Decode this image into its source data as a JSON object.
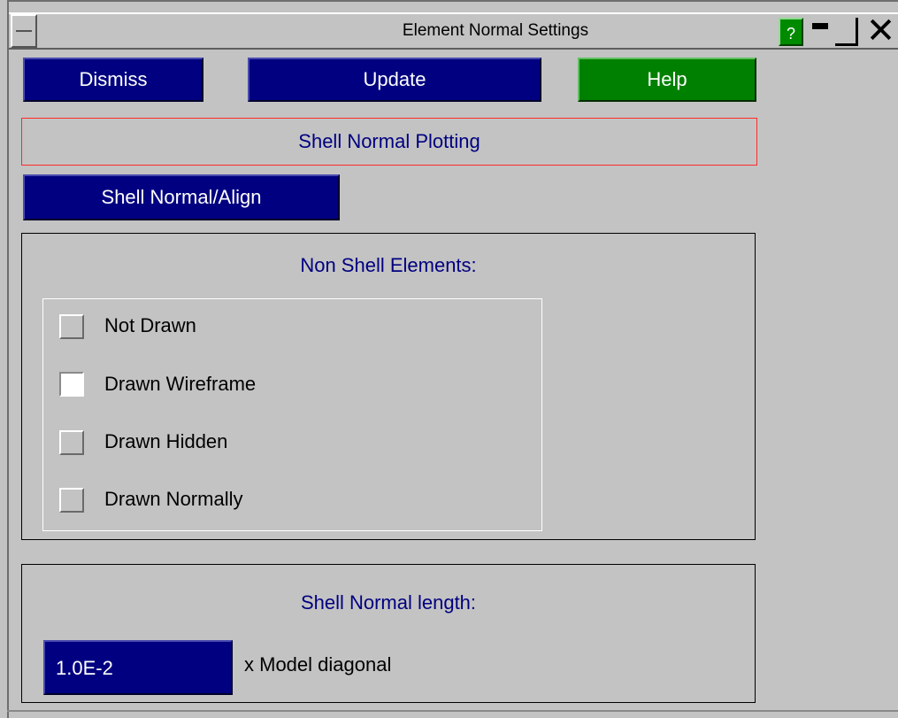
{
  "window": {
    "title": "Element Normal Settings",
    "help_glyph": "?",
    "close_glyph": "✕"
  },
  "toolbar": {
    "dismiss_label": "Dismiss",
    "update_label": "Update",
    "help_label": "Help"
  },
  "section_header": "Shell Normal Plotting",
  "align_button_label": "Shell Normal/Align",
  "non_shell": {
    "heading": "Non Shell Elements:",
    "options": [
      {
        "label": "Not Drawn",
        "selected": false
      },
      {
        "label": "Drawn Wireframe",
        "selected": true
      },
      {
        "label": "Drawn Hidden",
        "selected": false
      },
      {
        "label": "Drawn Normally",
        "selected": false
      }
    ]
  },
  "normal_length": {
    "heading": "Shell Normal length:",
    "value": "1.0E-2",
    "unit_label": "x Model diagonal"
  },
  "colors": {
    "background": "#c3c3c3",
    "button_blue": "#000080",
    "button_green": "#008000",
    "header_border": "#ff2a2a"
  }
}
